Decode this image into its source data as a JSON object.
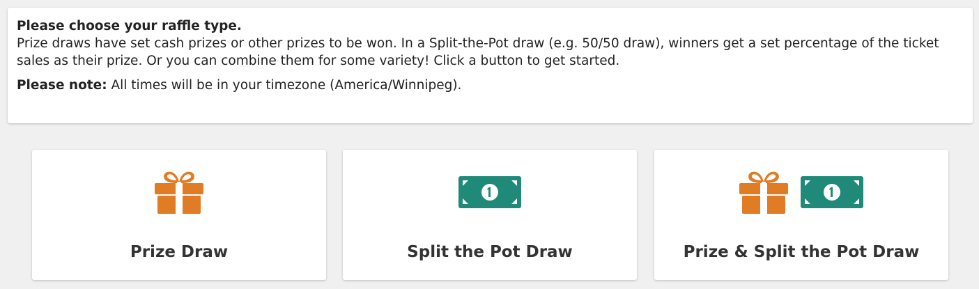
{
  "notice": {
    "heading": "Please choose your raffle type.",
    "body": "Prize draws have set cash prizes or other prizes to be won. In a Split-the-Pot draw (e.g. 50/50 draw), winners get a set percentage of the ticket sales as their prize. Or you can combine them for some variety! Click a button to get started.",
    "note_label": "Please note:",
    "note_text": " All times will be in your timezone (America/Winnipeg)."
  },
  "options": [
    {
      "label": "Prize Draw",
      "icons": [
        "gift-icon"
      ]
    },
    {
      "label": "Split the Pot Draw",
      "icons": [
        "money-bill-icon"
      ]
    },
    {
      "label": "Prize & Split the Pot Draw",
      "icons": [
        "gift-icon",
        "money-bill-icon"
      ]
    }
  ],
  "colors": {
    "gift": "#e07c24",
    "bill": "#1f8a7a",
    "background": "#f0f0f0",
    "panel": "#ffffff"
  }
}
